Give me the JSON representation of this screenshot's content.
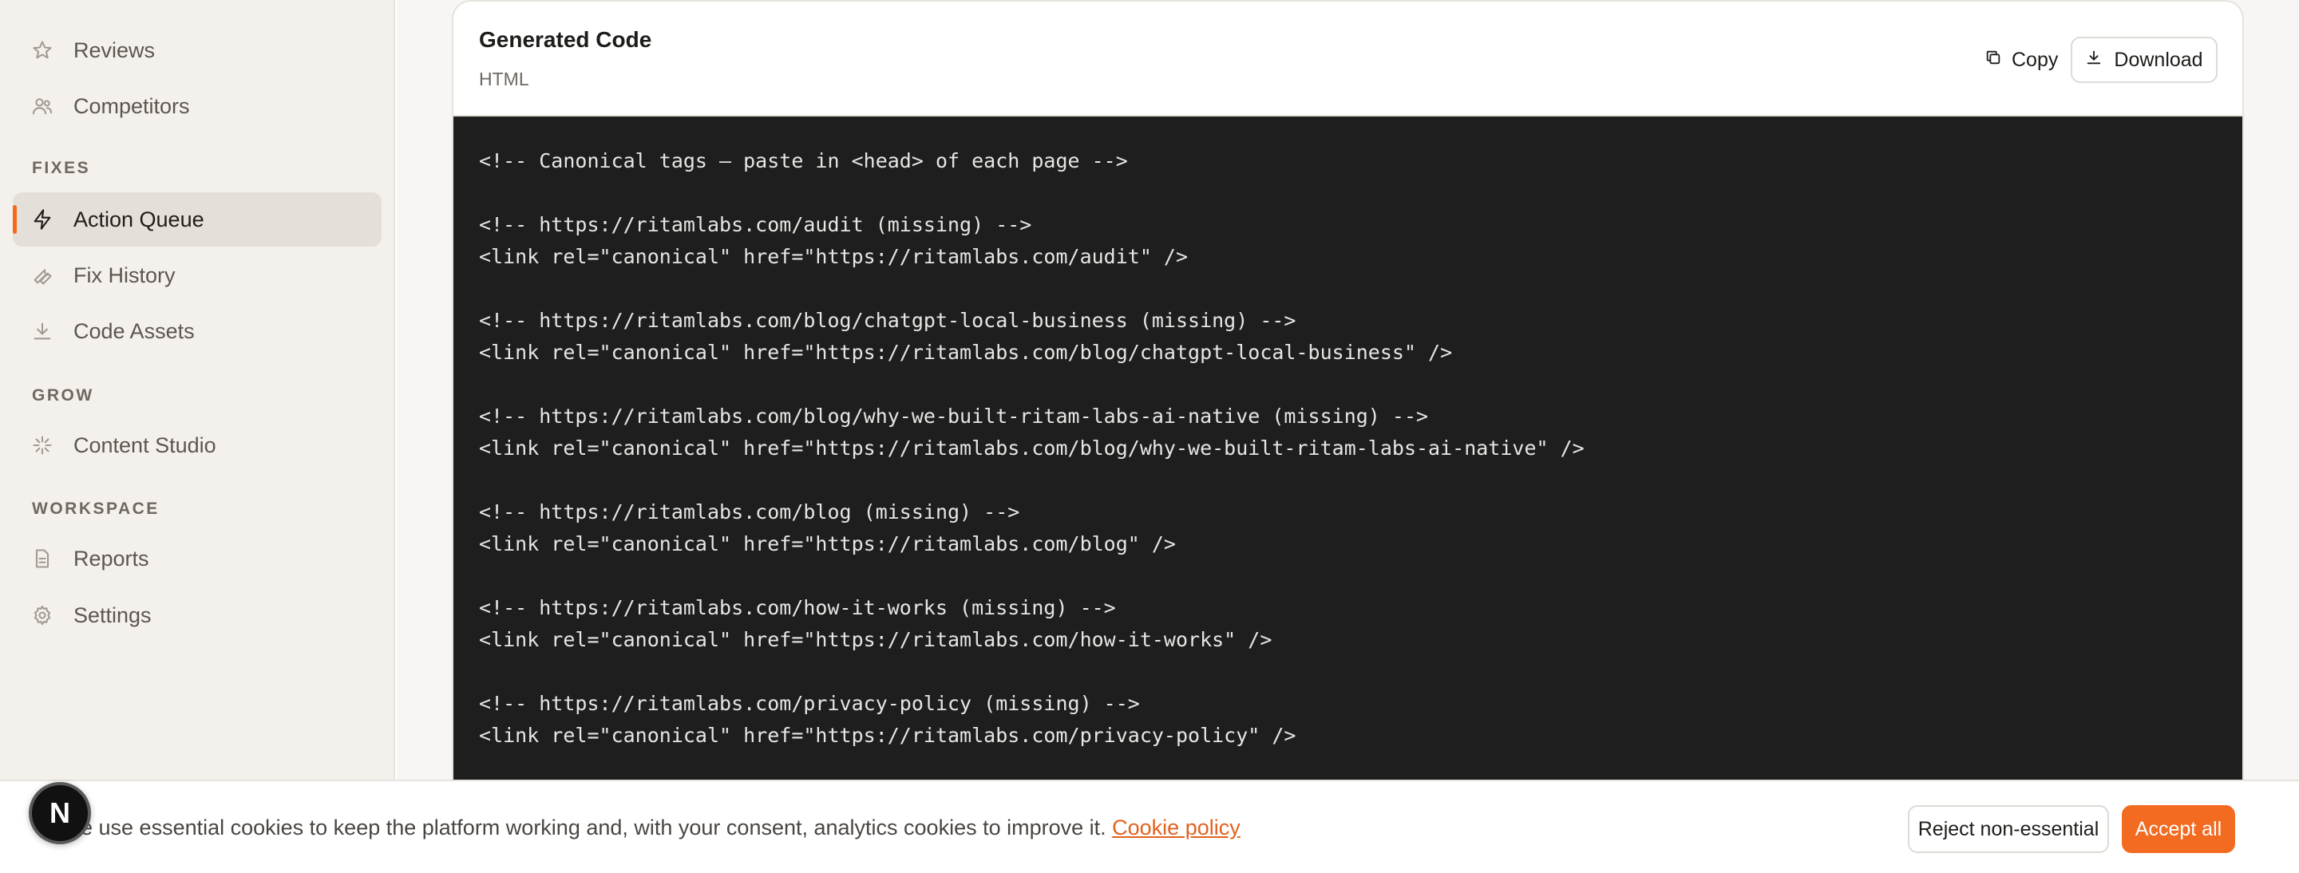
{
  "sidebar": {
    "items": [
      {
        "label": "Reviews",
        "icon": "star-icon"
      },
      {
        "label": "Competitors",
        "icon": "users-icon"
      },
      {
        "label": "Action Queue",
        "icon": "lightning-icon",
        "active": true
      },
      {
        "label": "Fix History",
        "icon": "wrench-icon"
      },
      {
        "label": "Code Assets",
        "icon": "download-icon"
      },
      {
        "label": "Content Studio",
        "icon": "sparkle-icon"
      },
      {
        "label": "Reports",
        "icon": "document-icon"
      },
      {
        "label": "Settings",
        "icon": "gear-icon"
      }
    ],
    "sections": {
      "fixes": "FIXES",
      "grow": "GROW",
      "workspace": "WORKSPACE"
    }
  },
  "card": {
    "title": "Generated Code",
    "subtitle": "HTML",
    "copy_label": "Copy",
    "download_label": "Download"
  },
  "code_lines": [
    "<!-- Canonical tags — paste in <head> of each page -->",
    "",
    "<!-- https://ritamlabs.com/audit (missing) -->",
    "<link rel=\"canonical\" href=\"https://ritamlabs.com/audit\" />",
    "",
    "<!-- https://ritamlabs.com/blog/chatgpt-local-business (missing) -->",
    "<link rel=\"canonical\" href=\"https://ritamlabs.com/blog/chatgpt-local-business\" />",
    "",
    "<!-- https://ritamlabs.com/blog/why-we-built-ritam-labs-ai-native (missing) -->",
    "<link rel=\"canonical\" href=\"https://ritamlabs.com/blog/why-we-built-ritam-labs-ai-native\" />",
    "",
    "<!-- https://ritamlabs.com/blog (missing) -->",
    "<link rel=\"canonical\" href=\"https://ritamlabs.com/blog\" />",
    "",
    "<!-- https://ritamlabs.com/how-it-works (missing) -->",
    "<link rel=\"canonical\" href=\"https://ritamlabs.com/how-it-works\" />",
    "",
    "<!-- https://ritamlabs.com/privacy-policy (missing) -->",
    "<link rel=\"canonical\" href=\"https://ritamlabs.com/privacy-policy\" />"
  ],
  "cookie": {
    "text": "We use essential cookies to keep the platform working and, with your consent, analytics cookies to improve it.",
    "link": "Cookie policy",
    "reject_label": "Reject non-essential",
    "accept_label": "Accept all"
  },
  "avatar": {
    "initial": "N"
  },
  "colors": {
    "accent": "#f26b21",
    "code_bg": "#1e1e1e",
    "sidebar_bg": "#f4f1ec"
  }
}
